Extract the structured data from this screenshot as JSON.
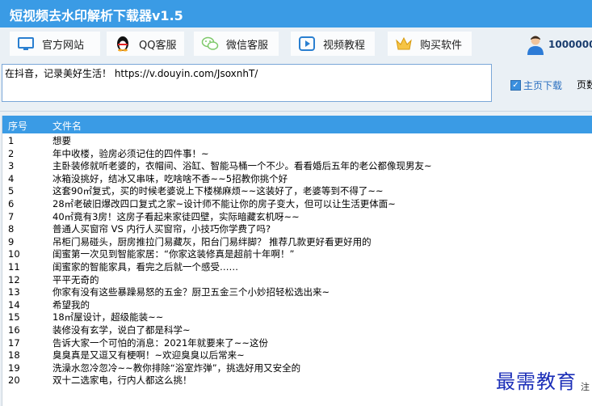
{
  "window": {
    "title": "短视频去水印解析下载器v1.5"
  },
  "toolbar": {
    "buttons": [
      {
        "label": "官方网站",
        "icon": "monitor-icon"
      },
      {
        "label": "QQ客服",
        "icon": "qq-penguin-icon"
      },
      {
        "label": "微信客服",
        "icon": "wechat-icon"
      },
      {
        "label": "视频教程",
        "icon": "play-icon"
      },
      {
        "label": "购买软件",
        "icon": "crown-icon"
      }
    ],
    "user": {
      "label": "1000000",
      "icon": "user-avatar-icon"
    }
  },
  "url_input": {
    "value": "在抖音，记录美好生活！ https://v.douyin.com/JsoxnhT/"
  },
  "options": {
    "homepage_download": {
      "label": "主页下载",
      "checked": true
    },
    "next_label": "页数"
  },
  "list": {
    "columns": [
      "序号",
      "文件名"
    ],
    "rows": [
      {
        "idx": "1",
        "name": "想要"
      },
      {
        "idx": "2",
        "name": "年中收楼，验房必须记住的四件事！~"
      },
      {
        "idx": "3",
        "name": "主卧装修就听老婆的，衣帽间、浴缸、智能马桶一个不少。看看婚后五年的老公都像现男友~"
      },
      {
        "idx": "4",
        "name": "冰箱没挑好，结冰又串味，吃啥啥不香~~5招教你挑个好"
      },
      {
        "idx": "5",
        "name": "这套90㎡复式，买的时候老婆说上下楼梯麻烦~~这装好了，老婆等到不得了~~"
      },
      {
        "idx": "6",
        "name": "28㎡老破旧爆改四口复式之家~设计师不能让你的房子变大，但可以让生活更体面~"
      },
      {
        "idx": "7",
        "name": "40㎡竟有3房！这房子看起来家徒四壁，实际暗藏玄机呀~~"
      },
      {
        "idx": "8",
        "name": "普通人买窗帘 VS 内行人买窗帘，小技巧你学费了吗?"
      },
      {
        "idx": "9",
        "name": "吊柜门易碰头，厨房推拉门易藏灰，阳台门易绊脚？ 推荐几款更好看更好用的"
      },
      {
        "idx": "10",
        "name": "闺蜜第一次见到智能家居：“你家这装修真是超前十年啊！”"
      },
      {
        "idx": "11",
        "name": "闺蜜家的智能家具，看完之后就一个感受……"
      },
      {
        "idx": "12",
        "name": "平平无奇的"
      },
      {
        "idx": "13",
        "name": "你家有没有这些暴躁易怒的五金？厨卫五金三个小妙招轻松选出来~"
      },
      {
        "idx": "14",
        "name": "希望我的"
      },
      {
        "idx": "15",
        "name": "18㎡屋设计，超级能装~~"
      },
      {
        "idx": "16",
        "name": "装修没有玄学，说白了都是科学~"
      },
      {
        "idx": "17",
        "name": "告诉大家一个可怕的消息：2021年就要来了~~这份"
      },
      {
        "idx": "18",
        "name": "臭臭真是又逗又有梗啊！~欢迎臭臭以后常来~"
      },
      {
        "idx": "19",
        "name": "洗澡水忽冷忽冷~~教你排除“浴室炸弹”，挑选好用又安全的"
      },
      {
        "idx": "20",
        "name": "双十二选家电，行内人都这么挑！"
      }
    ]
  },
  "watermark": {
    "text": "最需教育",
    "tail": "注"
  },
  "colors": {
    "accent": "#3a9be5",
    "watermark": "#1c2fb8"
  }
}
